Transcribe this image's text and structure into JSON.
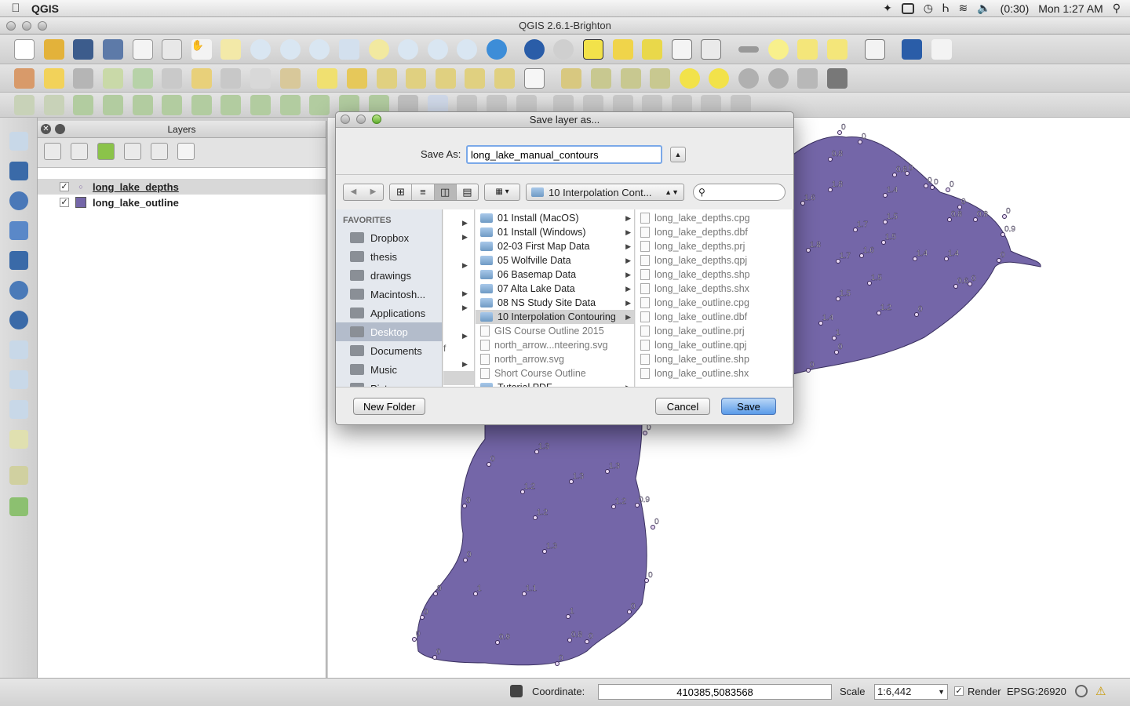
{
  "menubar": {
    "app_name": "QGIS",
    "battery": "(0:30)",
    "clock": "Mon 1:27 AM"
  },
  "window": {
    "title": "QGIS 2.6.1-Brighton"
  },
  "layers_panel": {
    "title": "Layers",
    "layers": [
      {
        "name": "long_lake_depths",
        "checked": true,
        "selected": true
      },
      {
        "name": "long_lake_outline",
        "checked": true,
        "selected": false
      }
    ],
    "outline_color": "#7466a8"
  },
  "dialog": {
    "title": "Save layer as...",
    "save_as_label": "Save As:",
    "filename": "long_lake_manual_contours",
    "current_folder": "10 Interpolation Cont...",
    "search_placeholder": "",
    "favorites_header": "FAVORITES",
    "favorites": [
      "Dropbox",
      "thesis",
      "drawings",
      "Macintosh...",
      "Applications",
      "Desktop",
      "Documents",
      "Music",
      "Pictures"
    ],
    "selected_favorite": "Desktop",
    "col1_stub": "f",
    "desktop_items": [
      {
        "name": "01 Install (MacOS)",
        "folder": true
      },
      {
        "name": "01 Install (Windows)",
        "folder": true
      },
      {
        "name": "02-03 First Map Data",
        "folder": true
      },
      {
        "name": "05 Wolfville Data",
        "folder": true
      },
      {
        "name": "06 Basemap Data",
        "folder": true
      },
      {
        "name": "07 Alta Lake Data",
        "folder": true
      },
      {
        "name": "08 NS Study Site Data",
        "folder": true
      },
      {
        "name": "10 Interpolation Contouring",
        "folder": true,
        "selected": true
      },
      {
        "name": "GIS Course Outline 2015",
        "folder": false
      },
      {
        "name": "north_arrow...nteering.svg",
        "folder": false
      },
      {
        "name": "north_arrow.svg",
        "folder": false
      },
      {
        "name": "Short Course Outline",
        "folder": false
      },
      {
        "name": "Tutorial PDF",
        "folder": true
      }
    ],
    "folder_files": [
      "long_lake_depths.cpg",
      "long_lake_depths.dbf",
      "long_lake_depths.prj",
      "long_lake_depths.qpj",
      "long_lake_depths.shp",
      "long_lake_depths.shx",
      "long_lake_outline.cpg",
      "long_lake_outline.dbf",
      "long_lake_outline.prj",
      "long_lake_outline.qpj",
      "long_lake_outline.shp",
      "long_lake_outline.shx"
    ],
    "new_folder_label": "New Folder",
    "cancel_label": "Cancel",
    "save_label": "Save"
  },
  "statusbar": {
    "coordinate_label": "Coordinate:",
    "coordinate_value": "410385,5083568",
    "scale_label": "Scale",
    "scale_value": "1:6,442",
    "render_label": "Render",
    "crs": "EPSG:26920"
  },
  "map_labels": [
    "0",
    "0",
    "0.8",
    "0.8",
    "0",
    "0",
    "1.6",
    "1.8",
    "1.4",
    "0",
    "0",
    "0",
    "0.8",
    "0.8",
    "0",
    "1.7",
    "1.5",
    "0.9",
    "1.8",
    "1.7",
    "1.6",
    "1.5",
    "1.4",
    "1.4",
    "0",
    "1.5",
    "0.6",
    "0",
    "1.5",
    "1.2",
    "0",
    "1.4",
    "1",
    "0",
    "0",
    "0",
    "1.3",
    "0",
    "1.3",
    "1.3",
    "0",
    "1.2",
    "1.2",
    "0.9",
    "0",
    "1.2",
    "0",
    "1.3",
    "0",
    "0",
    "1",
    "1.1",
    "0",
    "0",
    "1",
    "0",
    "0.9",
    "0.8",
    "0",
    "0",
    "0"
  ]
}
